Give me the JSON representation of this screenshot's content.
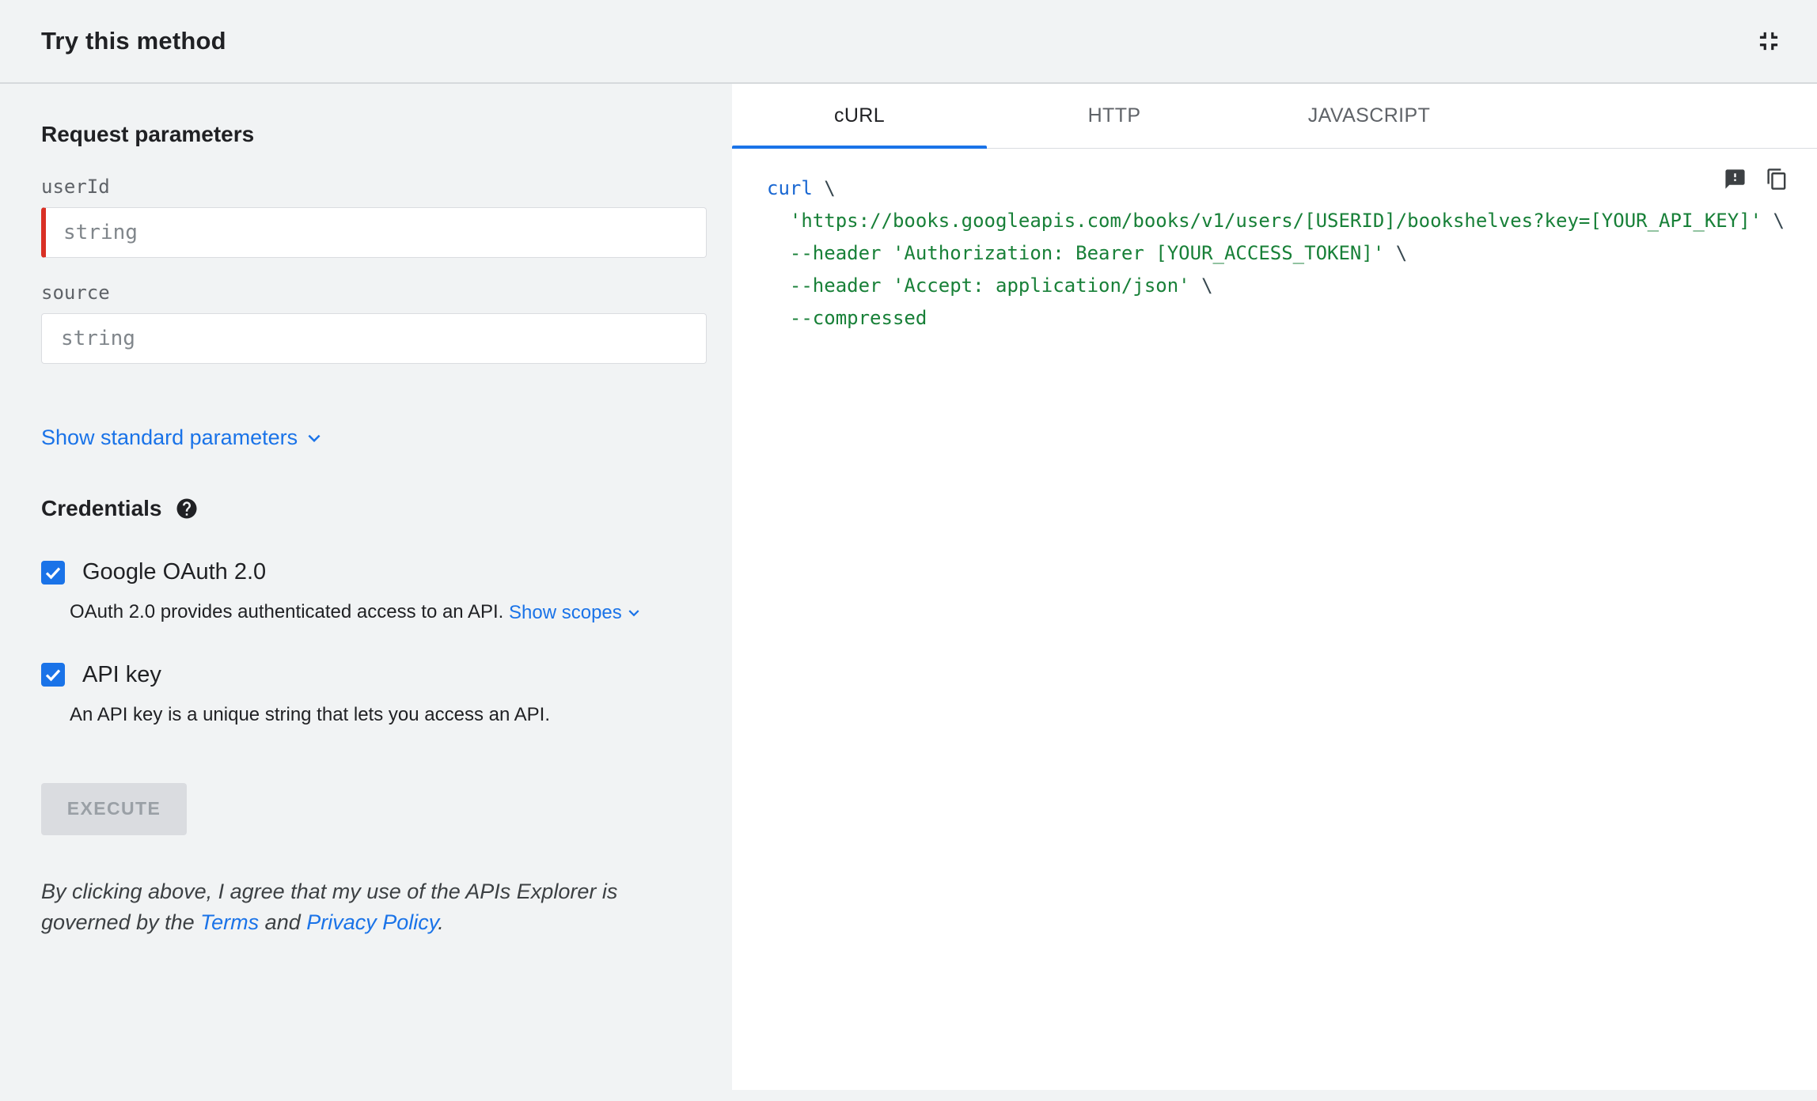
{
  "header": {
    "title": "Try this method"
  },
  "left": {
    "request_parameters_title": "Request parameters",
    "fields": [
      {
        "label": "userId",
        "placeholder": "string",
        "required": true
      },
      {
        "label": "source",
        "placeholder": "string",
        "required": false
      }
    ],
    "show_standard_parameters_label": "Show standard parameters",
    "credentials_title": "Credentials",
    "credentials": [
      {
        "label": "Google OAuth 2.0",
        "checked": true,
        "description": "OAuth 2.0 provides authenticated access to an API. ",
        "link_label": "Show scopes"
      },
      {
        "label": "API key",
        "checked": true,
        "description": "An API key is a unique string that lets you access an API."
      }
    ],
    "execute_label": "EXECUTE",
    "disclaimer": {
      "prefix": "By clicking above, I agree that my use of the APIs Explorer is governed by the ",
      "terms_link": "Terms",
      "middle": " and ",
      "privacy_link": "Privacy Policy",
      "suffix": "."
    }
  },
  "right": {
    "tabs": [
      {
        "label": "cURL",
        "active": true
      },
      {
        "label": "HTTP",
        "active": false
      },
      {
        "label": "JAVASCRIPT",
        "active": false
      }
    ],
    "code": {
      "language": "cURL",
      "lines": [
        [
          {
            "t": "curl",
            "c": "keyword"
          },
          {
            "t": " \\",
            "c": "plain"
          }
        ],
        [
          {
            "t": "  ",
            "c": "plain"
          },
          {
            "t": "'https://books.googleapis.com/books/v1/users/[USERID]/bookshelves?key=[YOUR_API_KEY]'",
            "c": "string"
          },
          {
            "t": " \\",
            "c": "plain"
          }
        ],
        [
          {
            "t": "  ",
            "c": "plain"
          },
          {
            "t": "--header 'Authorization: Bearer [YOUR_ACCESS_TOKEN]'",
            "c": "string"
          },
          {
            "t": " \\",
            "c": "plain"
          }
        ],
        [
          {
            "t": "  ",
            "c": "plain"
          },
          {
            "t": "--header 'Accept: application/json'",
            "c": "string"
          },
          {
            "t": " \\",
            "c": "plain"
          }
        ],
        [
          {
            "t": "  ",
            "c": "plain"
          },
          {
            "t": "--compressed",
            "c": "string"
          }
        ]
      ]
    }
  },
  "icons": {
    "header_right": "fullscreen-exit-icon",
    "credentials_help": "help-icon",
    "expand_links": "chevron-down-icon",
    "code_feedback": "feedback-icon",
    "code_copy": "copy-icon",
    "checkbox_mark": "checkmark-icon"
  },
  "colors": {
    "accent_blue": "#1a73e8",
    "required_red": "#d93025",
    "code_keyword_blue": "#1967d2",
    "code_string_green": "#188038",
    "code_plain_gray": "#37474f",
    "panel_bg": "#f1f3f4",
    "tab_underline_blue": "#1a73e8",
    "disabled_button_bg": "#dadce0",
    "disabled_button_text": "#9aa0a6"
  }
}
